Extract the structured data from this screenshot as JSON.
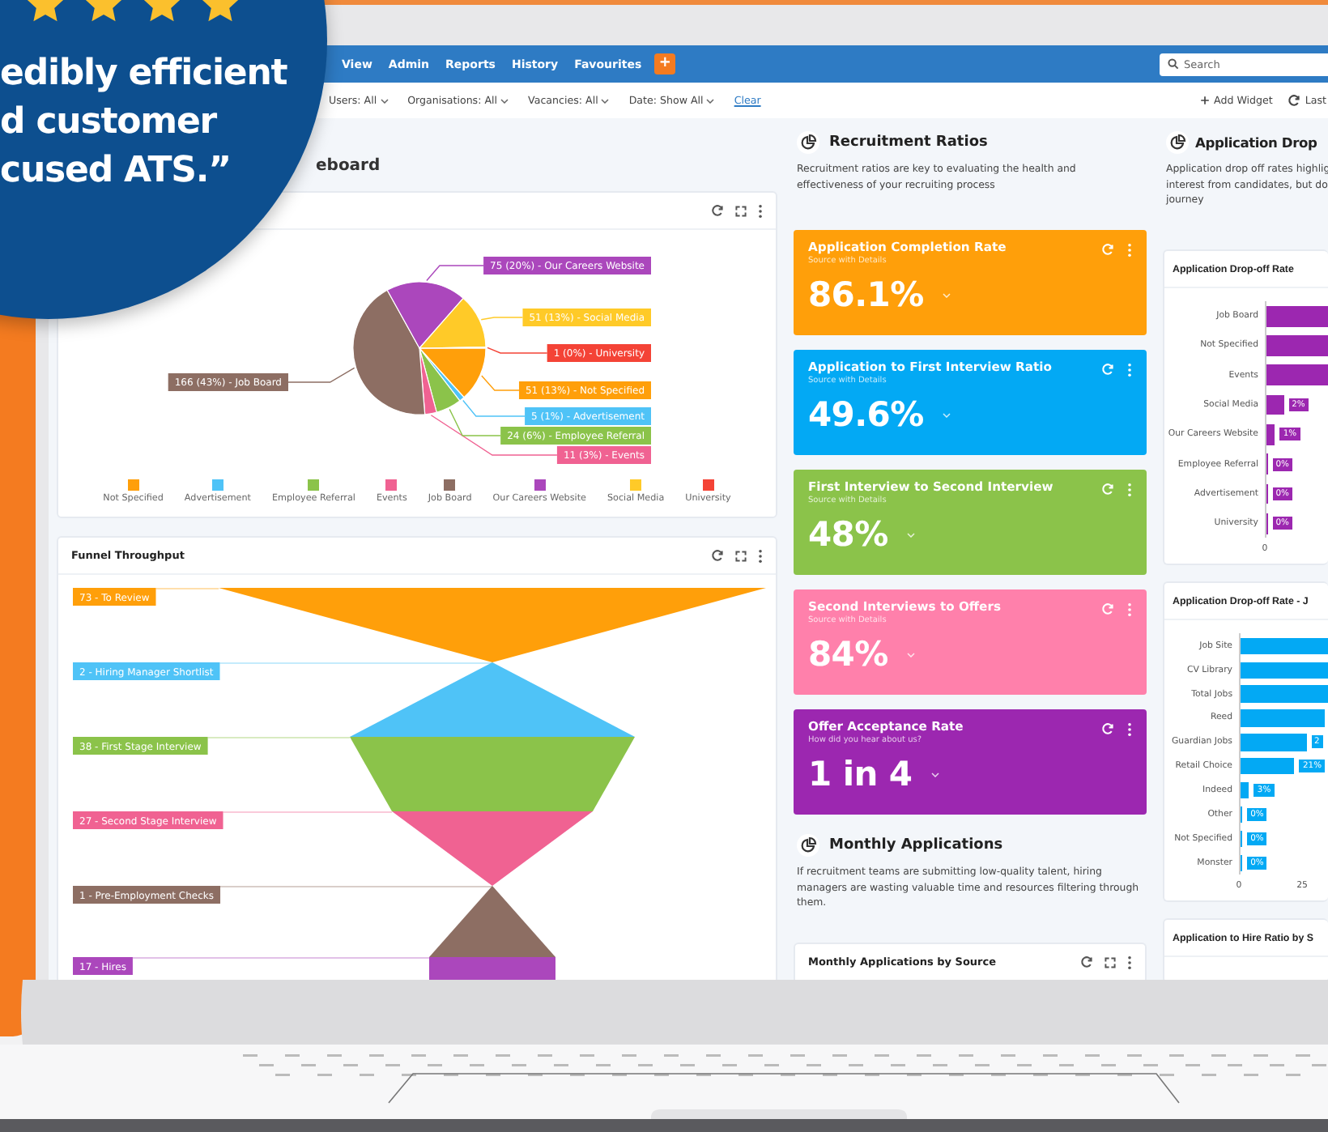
{
  "badge": {
    "stars": 4,
    "quote_lines": [
      "edibly efficient",
      "d customer",
      "cused ATS.”"
    ]
  },
  "nav": {
    "items": [
      "View",
      "Admin",
      "Reports",
      "History",
      "Favourites"
    ],
    "add_button": "+",
    "search": {
      "placeholder": "Search"
    }
  },
  "filters": {
    "items": [
      "Users: All",
      "Organisations: All",
      "Vacancies: All",
      "Date: Show All"
    ],
    "clear": "Clear",
    "actions": [
      "Add Widget",
      "Last"
    ]
  },
  "page_title": "eboard",
  "source_widget": {
    "chart_data": {
      "type": "pie",
      "categories": [
        "Not Specified",
        "Advertisement",
        "Employee Referral",
        "Events",
        "Job Board",
        "Our Careers Website",
        "Social Media",
        "University"
      ],
      "values": [
        51,
        5,
        24,
        11,
        166,
        75,
        51,
        1
      ],
      "value_labels": [
        "51 (13%) - Not Specified",
        "5 (1%) - Advertisement",
        "24 (6%) - Employee Referral",
        "11 (3%) - Events",
        "166 (43%) - Job Board",
        "75 (20%) - Our Careers Website",
        "51 (13%) - Social Media",
        "1 (0%) - University"
      ]
    },
    "legend": [
      {
        "color": "#ff9f0a"
      },
      {
        "color": "#4fc3f7"
      },
      {
        "color": "#8bc34a"
      },
      {
        "color": "#f06292"
      },
      {
        "color": "#8d6e63"
      },
      {
        "color": "#ab47bc"
      },
      {
        "color": "#ffca28"
      },
      {
        "color": "#f44336"
      }
    ]
  },
  "funnel": {
    "title": "Funnel Throughput",
    "stages": [
      {
        "label": "73 - To Review",
        "color": "#ff9f0a"
      },
      {
        "label": "2 - Hiring Manager Shortlist",
        "color": "#4fc3f7"
      },
      {
        "label": "38 - First Stage Interview",
        "color": "#8bc34a"
      },
      {
        "label": "27 - Second Stage Interview",
        "color": "#f06292"
      },
      {
        "label": "1 - Pre-Employment Checks",
        "color": "#8d6e63"
      },
      {
        "label": "17 - Hires",
        "color": "#ab47bc"
      }
    ]
  },
  "ratios": {
    "title": "Recruitment Ratios",
    "description": "Recruitment ratios are key to evaluating the health and effectiveness of your recruiting process",
    "cards": [
      {
        "title": "Application Completion Rate",
        "subtitle": "Source with Details",
        "value": "86.1%",
        "color": "#ff9f0a"
      },
      {
        "title": "Application to First Interview Ratio",
        "subtitle": "Source with Details",
        "value": "49.6%",
        "color": "#03a9f4"
      },
      {
        "title": "First Interview to Second Interview",
        "subtitle": "Source with Details",
        "value": "48%",
        "color": "#8bc34a"
      },
      {
        "title": "Second Interviews to Offers",
        "subtitle": "Source with Details",
        "value": "84%",
        "color": "#ff80ab"
      },
      {
        "title": "Offer Acceptance Rate",
        "subtitle": "How did you hear about us?",
        "value": "1 in 4",
        "color": "#9c27b0"
      }
    ]
  },
  "monthly": {
    "title": "Monthly Applications",
    "description": "If recruitment teams are submitting low-quality talent, hiring managers are wasting valuable time and resources filtering through them.",
    "widget_title": "Monthly Applications by Source"
  },
  "dropoff": {
    "title": "Application Drop",
    "description_lines": [
      "Application drop off rates highlig",
      "interest from candidates, but do",
      "journey"
    ],
    "charts": [
      {
        "title": "Application Drop-off Rate",
        "color": "#9c27b0",
        "ticks": [
          "0"
        ],
        "bars": [
          {
            "label": "Job Board",
            "level": 1
          },
          {
            "label": "Not Specified",
            "level": 1
          },
          {
            "label": "Events",
            "level": 1
          },
          {
            "label": "Social Media",
            "level": 0.28,
            "reading": "2%"
          },
          {
            "label": "Our Careers Website",
            "level": 0.14,
            "reading": "1%"
          },
          {
            "label": "Employee Referral",
            "level": 0.02,
            "reading": "0%"
          },
          {
            "label": "Advertisement",
            "level": 0.02,
            "reading": "0%"
          },
          {
            "label": "University",
            "level": 0.02,
            "reading": "0%"
          }
        ]
      },
      {
        "title": "Application Drop-off Rate - J",
        "color": "#03a9f4",
        "ticks": [
          "0",
          "25"
        ],
        "bars": [
          {
            "label": "Job Site",
            "level": 1
          },
          {
            "label": "CV Library",
            "level": 1
          },
          {
            "label": "Total Jobs",
            "level": 1
          },
          {
            "label": "Reed",
            "level": 0.97
          },
          {
            "label": "Guardian Jobs",
            "level": 0.75,
            "reading": "2"
          },
          {
            "label": "Retail Choice",
            "level": 0.62,
            "reading": "21%"
          },
          {
            "label": "Indeed",
            "level": 0.1,
            "reading": "3%"
          },
          {
            "label": "Other",
            "level": 0.02,
            "reading": "0%"
          },
          {
            "label": "Not Specified",
            "level": 0.02,
            "reading": "0%"
          },
          {
            "label": "Monster",
            "level": 0.02,
            "reading": "0%"
          }
        ]
      }
    ],
    "next_widget_title": "Application to Hire Ratio by S"
  }
}
